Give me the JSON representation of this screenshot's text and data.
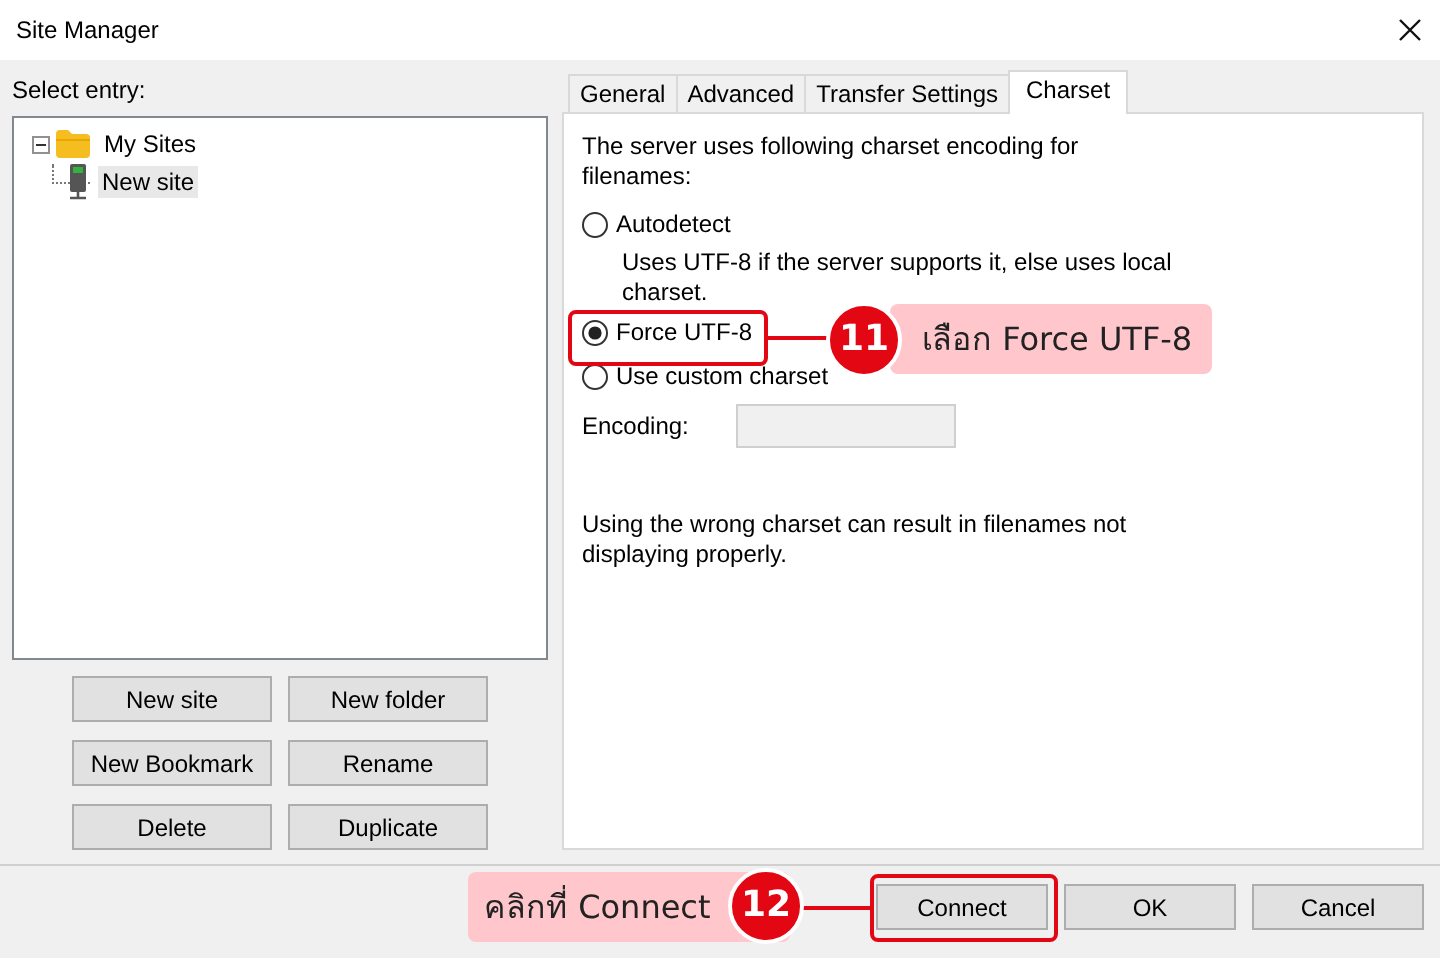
{
  "window": {
    "title": "Site Manager"
  },
  "entry_label": "Select entry:",
  "tree": [
    {
      "label": "My Sites",
      "kind": "folder",
      "expanded": true,
      "selected": false,
      "children": [
        {
          "label": "New site",
          "kind": "site",
          "selected": true
        }
      ]
    }
  ],
  "tree_buttons": [
    "New site",
    "New folder",
    "New Bookmark",
    "Rename",
    "Delete",
    "Duplicate"
  ],
  "tabs": [
    {
      "label": "General",
      "selected": false
    },
    {
      "label": "Advanced",
      "selected": false
    },
    {
      "label": "Transfer Settings",
      "selected": false
    },
    {
      "label": "Charset",
      "selected": true
    }
  ],
  "charset": {
    "intro": "The server uses following charset encoding for filenames:",
    "options": [
      {
        "label": "Autodetect",
        "selected": false,
        "note": "Uses UTF-8 if the server supports it, else uses local charset."
      },
      {
        "label": "Force UTF-8",
        "selected": true
      },
      {
        "label": "Use custom charset",
        "selected": false
      }
    ],
    "encoding": {
      "label": "Encoding:",
      "disabled": true
    },
    "warning": "Using the wrong charset can result in filenames not displaying properly."
  },
  "dialog_buttons": [
    "Connect",
    "OK",
    "Cancel"
  ],
  "annotations": [
    {
      "number": "11",
      "text": "เลือก Force UTF-8"
    },
    {
      "number": "12",
      "text": "คลิกที่ Connect"
    }
  ]
}
